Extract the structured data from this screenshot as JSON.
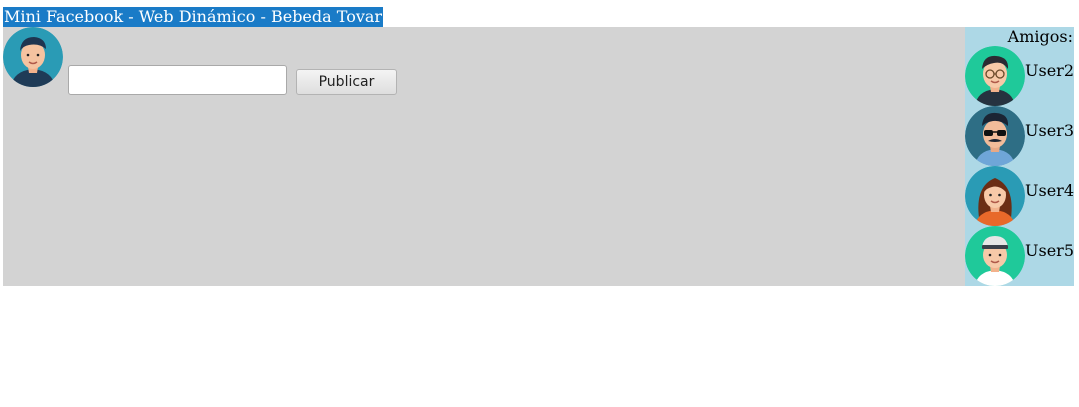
{
  "window": {
    "title": "Mini Facebook - Web Dinámico - Bebeda Tovar"
  },
  "composer": {
    "avatar_icon": "user-male-avatar-icon",
    "input_value": "",
    "input_placeholder": "",
    "publish_label": "Publicar"
  },
  "friends": {
    "heading": "Amigos:",
    "items": [
      {
        "name": "User2",
        "icon": "user-glasses-avatar-icon"
      },
      {
        "name": "User3",
        "icon": "user-sunglasses-mustache-avatar-icon"
      },
      {
        "name": "User4",
        "icon": "user-female-avatar-icon"
      },
      {
        "name": "User5",
        "icon": "user-cap-avatar-icon"
      }
    ]
  },
  "colors": {
    "title_background": "#1a7bc7",
    "main_panel": "#d3d3d3",
    "friends_panel": "#add8e6"
  }
}
